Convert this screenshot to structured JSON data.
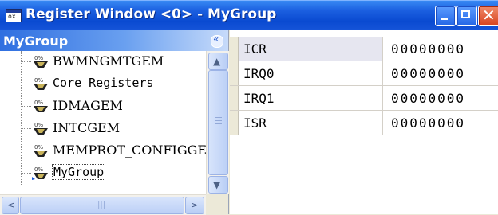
{
  "window": {
    "title": "Register Window <0> - MyGroup",
    "app_icon_text": "ox"
  },
  "title_buttons": [
    "minimize-icon",
    "maximize-icon",
    "close-icon"
  ],
  "left_pane": {
    "header": "MyGroup",
    "collapse_glyph": "«",
    "tree_items": [
      {
        "label": "BWMNGMTGEM",
        "icon": "register-group-icon"
      },
      {
        "label": "Core Registers",
        "icon": "register-group-icon"
      },
      {
        "label": "IDMAGEM",
        "icon": "register-group-icon"
      },
      {
        "label": "INTCGEM",
        "icon": "register-group-icon"
      },
      {
        "label": "MEMPROT_CONFIGGEM",
        "icon": "register-group-icon"
      },
      {
        "label": "MyGroup",
        "icon": "register-group-icon",
        "selected": true
      }
    ],
    "scroll_up": "▲",
    "scroll_down": "▼",
    "scroll_left": "<",
    "scroll_right": ">",
    "hscroll_grip": "|||"
  },
  "registers": [
    {
      "name": "ICR",
      "value": "00000000"
    },
    {
      "name": "IRQ0",
      "value": "00000000"
    },
    {
      "name": "IRQ1",
      "value": "00000000"
    },
    {
      "name": "ISR",
      "value": "00000000"
    }
  ],
  "colors": {
    "title_bar": "#0a4ad1",
    "close_button": "#d8431f",
    "group_header": "#2f6fe0",
    "window_bg": "#ece9d8"
  }
}
